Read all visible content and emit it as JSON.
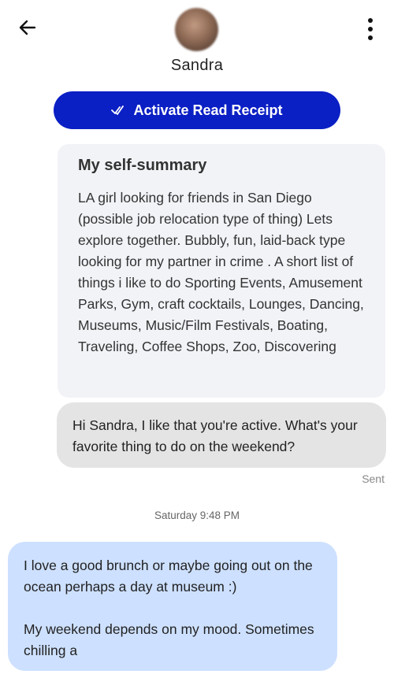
{
  "header": {
    "contact_name": "Sandra",
    "read_receipt_label": "Activate Read Receipt",
    "read_receipt_color": "#0a1fc4"
  },
  "icons": {
    "back": "arrow-left-icon",
    "menu": "more-vertical-icon",
    "read_receipt": "double-check-icon"
  },
  "profile_summary": {
    "title": "My self-summary",
    "text": "LA girl looking for friends in San Diego (possible job relocation type of thing) Lets explore together. Bubbly, fun, laid-back type looking for my partner in crime . A short list of things i like to do Sporting Events, Amusement Parks, Gym, craft cocktails, Lounges, Dancing, Museums, Music/Film Festivals, Boating, Traveling, Coffee Shops, Zoo, Discovering"
  },
  "messages": {
    "sent_text": "Hi Sandra, I like that you're active. What's your favorite thing to do on the weekend?",
    "sent_status": "Sent",
    "timestamp": "Saturday 9:48 PM",
    "received_paragraphs": [
      "I love a good brunch or maybe going out on the ocean perhaps a day at museum :)",
      "My weekend depends on my mood. Sometimes chilling a"
    ],
    "sent_bubble_color": "#e4e4e4",
    "received_bubble_color": "#cde0ff"
  }
}
